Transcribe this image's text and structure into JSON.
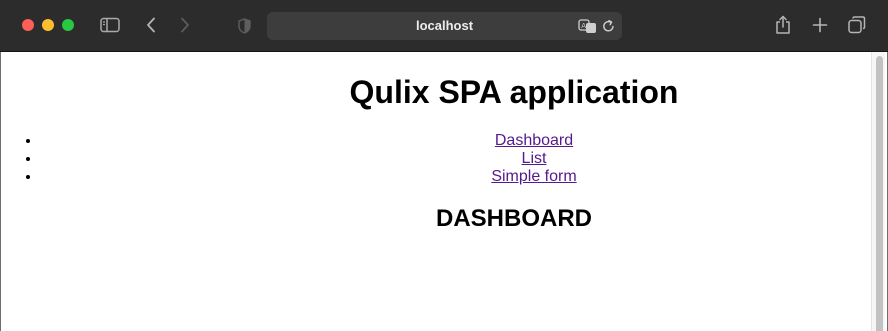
{
  "browser": {
    "address": "localhost",
    "icons": [
      "sidebar-icon",
      "back-icon",
      "forward-icon",
      "shield-icon",
      "translate-icon",
      "reload-icon",
      "share-icon",
      "new-tab-icon",
      "tab-overview-icon"
    ]
  },
  "page": {
    "title": "Qulix SPA application",
    "nav": [
      {
        "label": "Dashboard"
      },
      {
        "label": "List"
      },
      {
        "label": "Simple form"
      }
    ],
    "section_title": "DASHBOARD"
  },
  "colors": {
    "chrome_bg": "#2d2c2c",
    "address_bg": "#3e3d3d",
    "visited_link": "#551a8b"
  }
}
